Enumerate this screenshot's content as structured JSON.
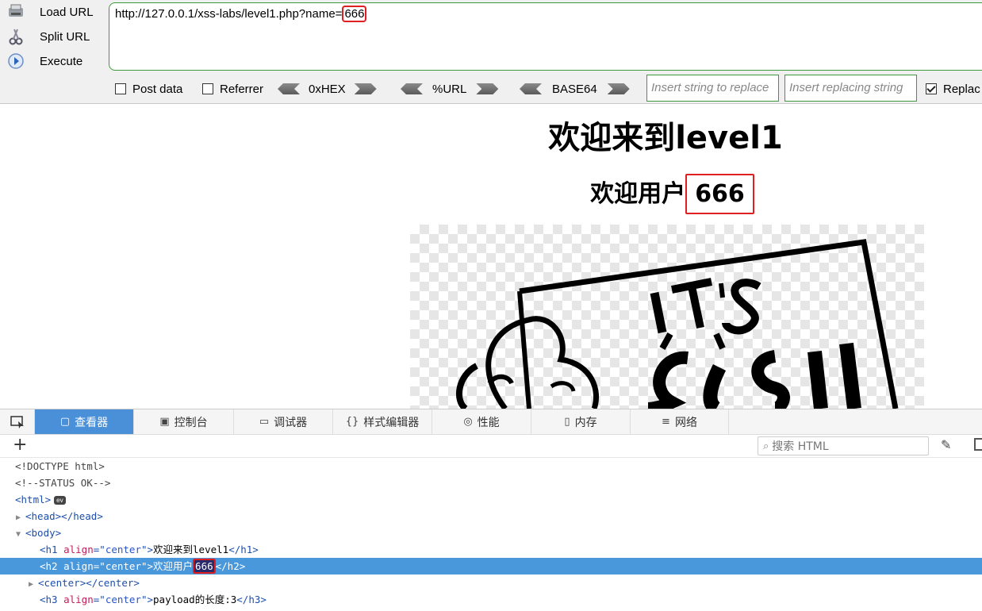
{
  "hackbar": {
    "buttons": [
      {
        "label": "Load URL",
        "icon": "load-url-icon"
      },
      {
        "label": "Split URL",
        "icon": "split-url-icon"
      },
      {
        "label": "Execute",
        "icon": "execute-icon"
      }
    ],
    "url_prefix": "http://127.0.0.1/xss-labs/level1.php?name=",
    "url_highlight": "666",
    "options": {
      "post_data": "Post data",
      "referrer": "Referrer",
      "replace": "Replac"
    },
    "encoders": [
      "0xHEX",
      "%URL",
      "BASE64"
    ],
    "replace_placeholder_1": "Insert string to replace",
    "replace_placeholder_2": "Insert replacing string"
  },
  "page": {
    "h1": "欢迎来到level1",
    "h2_prefix": "欢迎用户",
    "h2_value": "666",
    "image_text_1": "IT'S",
    "image_text_2": "Easy"
  },
  "devtools": {
    "tabs": [
      "查看器",
      "控制台",
      "调试器",
      "样式编辑器",
      "性能",
      "内存",
      "网络"
    ],
    "active_tab": "查看器",
    "search_placeholder": "搜索 HTML",
    "lines": {
      "doctype": "<!DOCTYPE html>",
      "comment": "<!--STATUS OK-->",
      "html_tag": "html",
      "ev_badge": "ev",
      "head_tag": "head",
      "body_tag": "body",
      "h1_text": "欢迎来到level1",
      "h2_text": "欢迎用户",
      "h2_value": "666",
      "center_tag": "center",
      "h3_text": "payload的长度:3",
      "align_attr": "align",
      "align_val": "center"
    }
  }
}
